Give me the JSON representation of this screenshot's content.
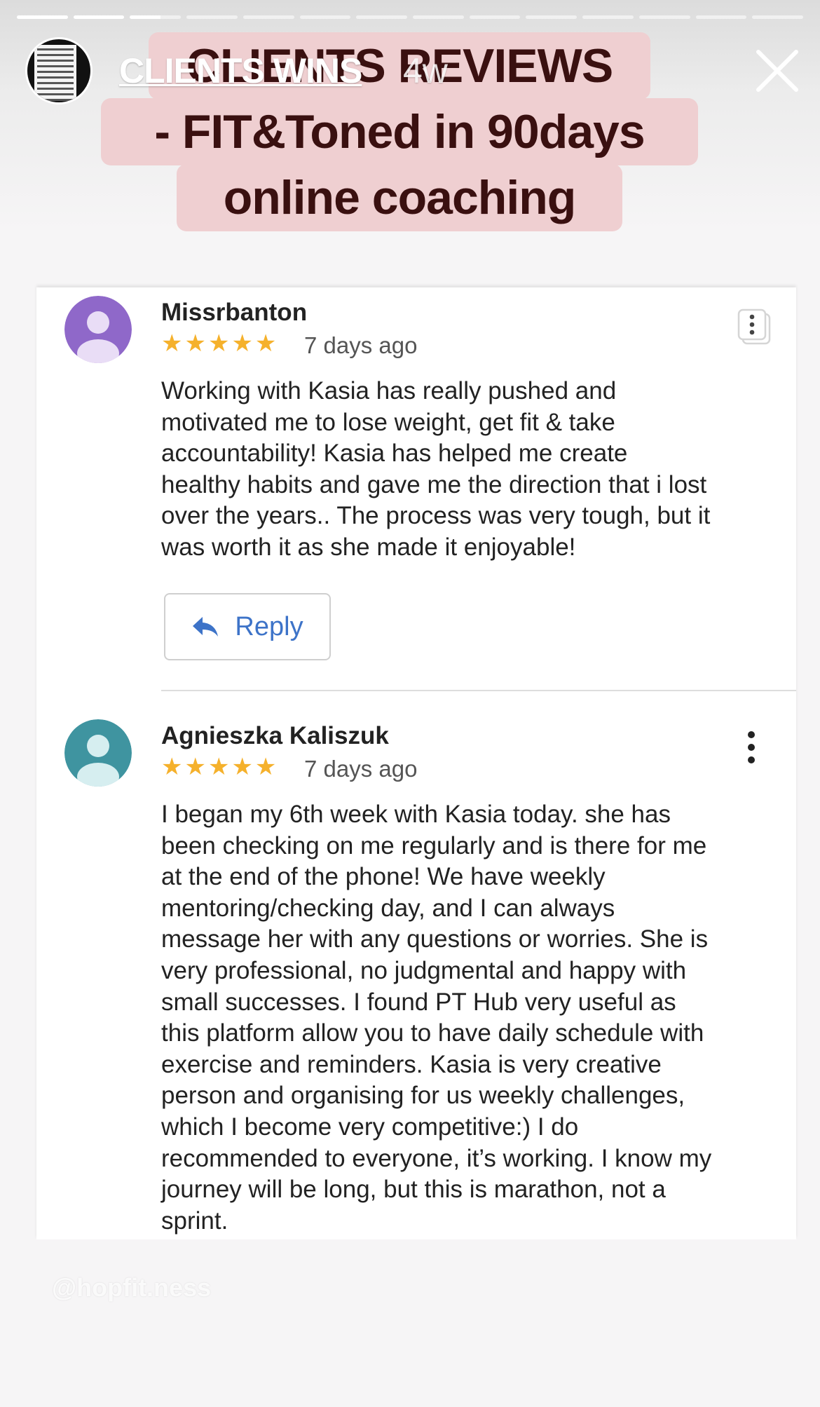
{
  "story": {
    "progress": {
      "segments": 14,
      "completed": 2,
      "current_fraction": 0.6
    },
    "header": {
      "username": "CLIENTS WINS",
      "time": "4w"
    },
    "title": {
      "lines": [
        "CLIENTS REVIEWS",
        "- FIT&Toned in 90days",
        "online coaching"
      ]
    },
    "handle": "@hopfit.ness"
  },
  "reviews": [
    {
      "name": "Missrbanton",
      "stars": "★★★★★",
      "rating": 5,
      "time": "7 days ago",
      "lines": [
        "Working with Kasia has really pushed and",
        "motivated me to lose weight, get fit & take",
        "accountability! Kasia has helped me create",
        "healthy habits and gave me the direction that i lost",
        "over the years.. The process was very tough, but it",
        "was worth it as she made it enjoyable!"
      ],
      "reply_label": "Reply"
    },
    {
      "name": "Agnieszka Kaliszuk",
      "stars": "★★★★★",
      "rating": 5,
      "time": "7 days ago",
      "lines": [
        "I began my 6th week with Kasia today. she has",
        "been checking on me regularly and is there for me",
        "at the end of the phone! We have weekly",
        "mentoring/checking day, and I can always",
        "message her with any questions or worries. She is",
        "very professional, no judgmental and happy with",
        "small successes. I found PT Hub very useful as",
        "this platform allow you to have daily schedule with",
        "exercise and reminders. Kasia is very creative",
        "person and organising for us weekly challenges,",
        "which I become very competitive:) I do",
        "recommended to everyone, it’s working. I know my",
        "journey will be long, but this is marathon, not a",
        "sprint."
      ]
    }
  ],
  "colors": {
    "avatar_1": "#8f68c9",
    "avatar_2": "#3f94a0",
    "star": "#f5b12c",
    "reply": "#3d73c8",
    "title_bg": "#efcfd1",
    "title_text": "#3a1010"
  },
  "icons": [
    "close-icon",
    "reply-arrow-icon",
    "more-vert-icon",
    "person-icon",
    "copy-icon"
  ]
}
